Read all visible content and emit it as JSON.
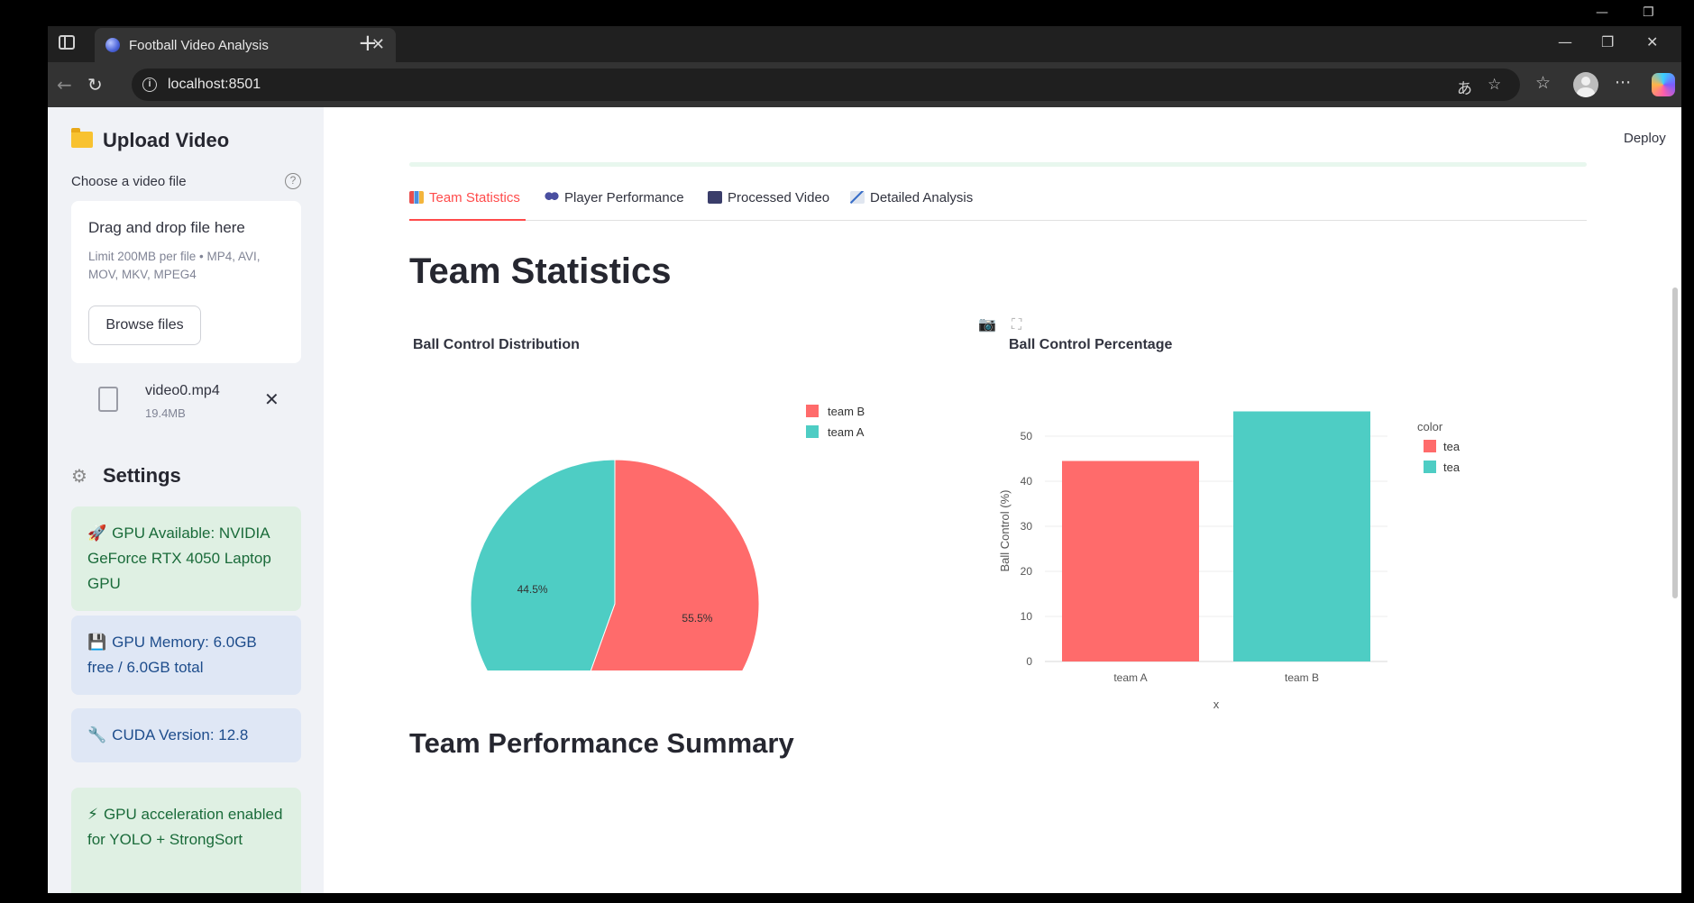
{
  "browser": {
    "tab_title": "Football Video Analysis",
    "url": "localhost:8501"
  },
  "sidebar": {
    "upload_title": "Upload Video",
    "uploader_label": "Choose a video file",
    "dropzone_title": "Drag and drop file here",
    "dropzone_limit": "Limit 200MB per file • MP4, AVI, MOV, MKV, MPEG4",
    "browse_label": "Browse files",
    "file_name": "video0.mp4",
    "file_size": "19.4MB",
    "settings_title": "Settings",
    "alerts": [
      {
        "emoji": "🚀",
        "text": "GPU Available: NVIDIA GeForce RTX 4050 Laptop GPU",
        "kind": "success"
      },
      {
        "emoji": "💾",
        "text": "GPU Memory: 6.0GB free / 6.0GB total",
        "kind": "info"
      },
      {
        "emoji": "🔧",
        "text": "CUDA Version: 12.8",
        "kind": "info"
      },
      {
        "emoji": "⚡",
        "text": "GPU acceleration enabled for YOLO + StrongSort",
        "kind": "success"
      }
    ]
  },
  "header": {
    "deploy_label": "Deploy"
  },
  "tabs": [
    {
      "label": "Team Statistics",
      "icon": "bar-chart-icon",
      "active": true
    },
    {
      "label": "Player Performance",
      "icon": "people-icon",
      "active": false
    },
    {
      "label": "Processed Video",
      "icon": "film-icon",
      "active": false
    },
    {
      "label": "Detailed Analysis",
      "icon": "line-chart-icon",
      "active": false
    }
  ],
  "main": {
    "heading": "Team Statistics",
    "summary_heading": "Team Performance Summary"
  },
  "colors": {
    "team_A": "#4ecdc4",
    "team_B": "#ff6b6b",
    "accent": "#ff4b4b"
  },
  "chart_data": [
    {
      "type": "pie",
      "title": "Ball Control Distribution",
      "labels": [
        "team B",
        "team A"
      ],
      "values": [
        55.5,
        44.5
      ],
      "value_labels": [
        "55.5%",
        "44.5%"
      ],
      "colors": [
        "#ff6b6b",
        "#4ecdc4"
      ],
      "legend": [
        "team B",
        "team A"
      ],
      "legend_position": "top-right"
    },
    {
      "type": "bar",
      "title": "Ball Control Percentage",
      "categories": [
        "team A",
        "team B"
      ],
      "values": [
        44.5,
        55.5
      ],
      "colors": [
        "#ff6b6b",
        "#4ecdc4"
      ],
      "xlabel": "x",
      "ylabel": "Ball Control (%)",
      "ylim": [
        0,
        58
      ],
      "yticks": [
        0,
        10,
        20,
        30,
        40,
        50
      ],
      "legend_title": "color",
      "legend": [
        "team A",
        "team B"
      ],
      "legend_position": "top-right",
      "grid": true
    }
  ]
}
